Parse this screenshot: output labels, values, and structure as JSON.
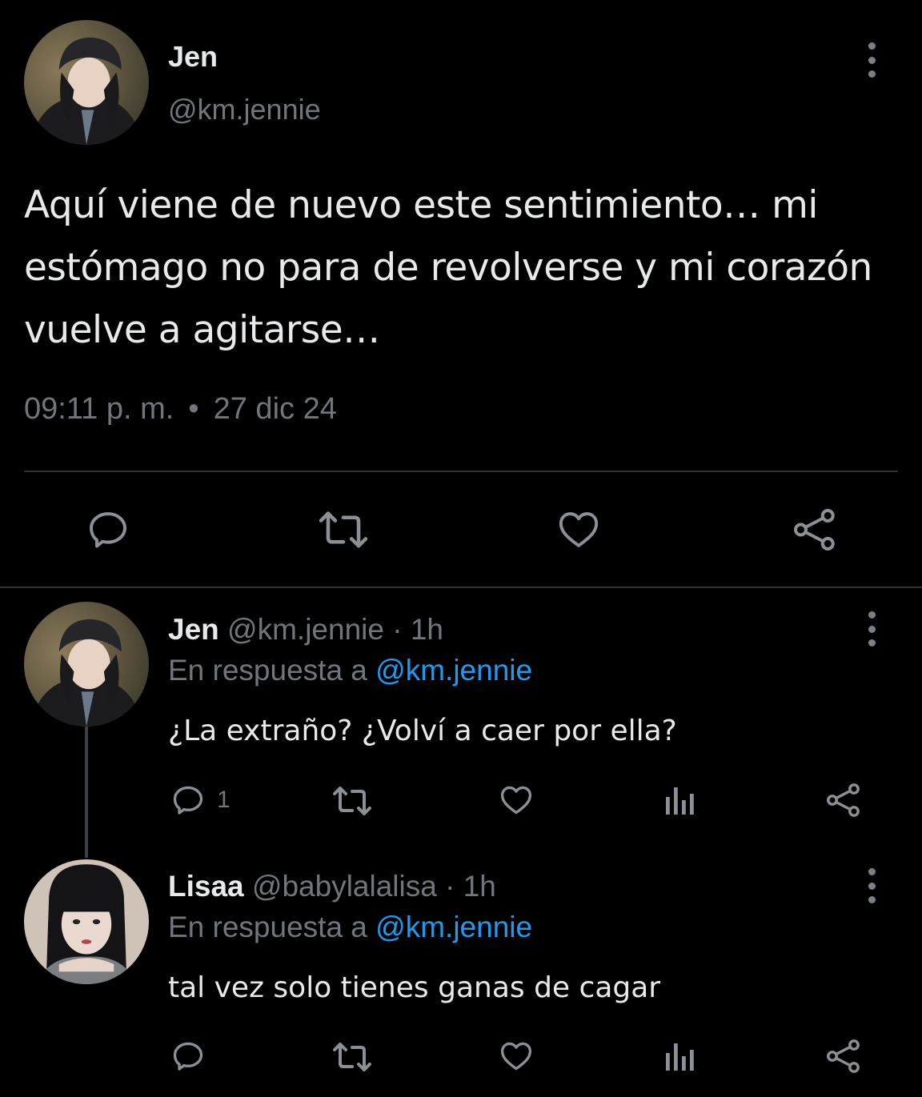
{
  "main_tweet": {
    "name": "Jen",
    "handle": "@km.jennie",
    "text": "Aquí viene de nuevo este sentimiento… mi estómago no para de revolverse y mi corazón vuelve a agitarse…",
    "time": "09:11 p. m.",
    "separator": "•",
    "date": "27 dic 24",
    "actions": [
      "reply-icon",
      "retweet-icon",
      "like-icon",
      "share-icon"
    ]
  },
  "replies": [
    {
      "name": "Jen",
      "handle": "@km.jennie",
      "age": "· 1h",
      "reply_prefix": "En respuesta a",
      "reply_to": "@km.jennie",
      "text": "¿La extraño? ¿Volví a caer por ella?",
      "reply_count": "1",
      "actions": [
        "reply-icon",
        "retweet-icon",
        "like-icon",
        "views-icon",
        "share-icon"
      ]
    },
    {
      "name": "Lisaa",
      "handle": "@babylalalisa",
      "age": "· 1h",
      "reply_prefix": "En respuesta a",
      "reply_to": "@km.jennie",
      "text": "tal vez solo tienes ganas de cagar",
      "reply_count": "",
      "actions": [
        "reply-icon",
        "retweet-icon",
        "like-icon",
        "views-icon",
        "share-icon"
      ]
    }
  ],
  "colors": {
    "background": "#000000",
    "text": "#e7e9ea",
    "muted": "#71767b",
    "link": "#1d9bf0",
    "divider": "#2f3336"
  }
}
